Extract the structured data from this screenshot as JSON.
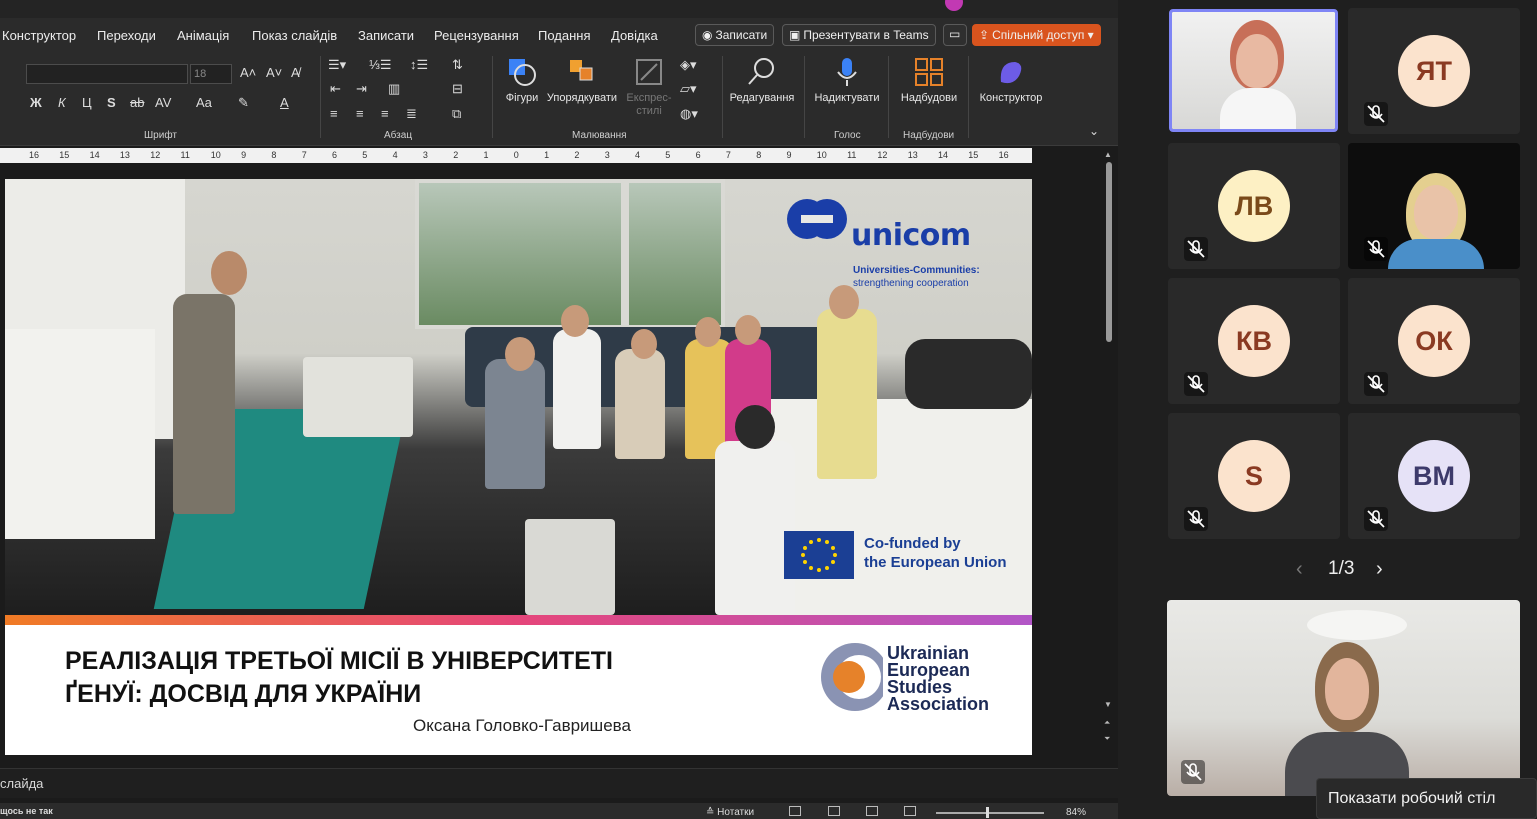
{
  "menu": {
    "items": [
      "Конструктор",
      "Переходи",
      "Анімація",
      "Показ слайдів",
      "Записати",
      "Рецензування",
      "Подання",
      "Довідка"
    ],
    "record_btn": "Записати",
    "present_teams_btn": "Презентувати в Teams",
    "share_btn": "Спільний доступ"
  },
  "ribbon": {
    "font_size": "18",
    "groups": {
      "font": "Шрифт",
      "paragraph": "Абзац",
      "drawing": "Малювання",
      "voice": "Голос",
      "addins": "Надбудови"
    },
    "buttons": {
      "shapes": "Фігури",
      "arrange": "Упорядкувати",
      "quick_styles_line1": "Експрес-",
      "quick_styles_line2": "стилі",
      "editing": "Редагування",
      "dictate": "Надиктувати",
      "addins": "Надбудови",
      "designer": "Конструктор"
    }
  },
  "ruler": {
    "labels": [
      "16",
      "15",
      "14",
      "13",
      "12",
      "11",
      "10",
      "9",
      "8",
      "7",
      "6",
      "5",
      "4",
      "3",
      "2",
      "1",
      "0",
      "1",
      "2",
      "3",
      "4",
      "5",
      "6",
      "7",
      "8",
      "9",
      "10",
      "11",
      "12",
      "13",
      "14",
      "15",
      "16"
    ]
  },
  "slide": {
    "title_line1": "РЕАЛІЗАЦІЯ ТРЕТЬОЇ МІСІЇ В УНІВЕРСИТЕТІ",
    "title_line2": "ҐЕНУЇ: ДОСВІД ДЛЯ УКРАЇНИ",
    "author": "Оксана Головко-Гавришева",
    "unicom_word": "unicom",
    "unicom_tag1": "Universities-Communities:",
    "unicom_tag2": "strengthening cooperation",
    "eu_line1": "Co-funded by",
    "eu_line2": "the European Union",
    "uesa_line1": "Ukrainian",
    "uesa_line2": "European",
    "uesa_line3": "Studies",
    "uesa_line4": "Association"
  },
  "notes": {
    "placeholder": "слайда"
  },
  "status": {
    "left_text": "щось не так",
    "notes_btn": "Нотатки",
    "zoom": "84%"
  },
  "teams": {
    "participants": [
      {
        "initials": "",
        "video": true
      },
      {
        "initials": "ЯТ",
        "video": false
      },
      {
        "initials": "ЛВ",
        "video": false
      },
      {
        "initials": "",
        "video": true
      },
      {
        "initials": "КВ",
        "video": false
      },
      {
        "initials": "ОК",
        "video": false
      },
      {
        "initials": "S",
        "video": false
      },
      {
        "initials": "ВМ",
        "video": false
      }
    ],
    "pager": "1/3",
    "tooltip": "Показати робочий стіл"
  },
  "colors": {
    "accent_share": "#d9541e",
    "active_border": "#7f85f5",
    "avatar_peach": "#fbe3cd",
    "avatar_lav": "#e6e2f7",
    "avatar_text_brown": "#8a3a22",
    "avatar_text_purple": "#3d3a6b"
  },
  "icons": [
    "record-icon",
    "teams-icon",
    "share-icon",
    "comment-icon",
    "shapes-icon",
    "arrange-icon",
    "quickstyles-icon",
    "search-icon",
    "mic-icon",
    "addins-icon",
    "designer-icon",
    "mic-muted-icon",
    "chevron-left-icon",
    "chevron-right-icon"
  ]
}
